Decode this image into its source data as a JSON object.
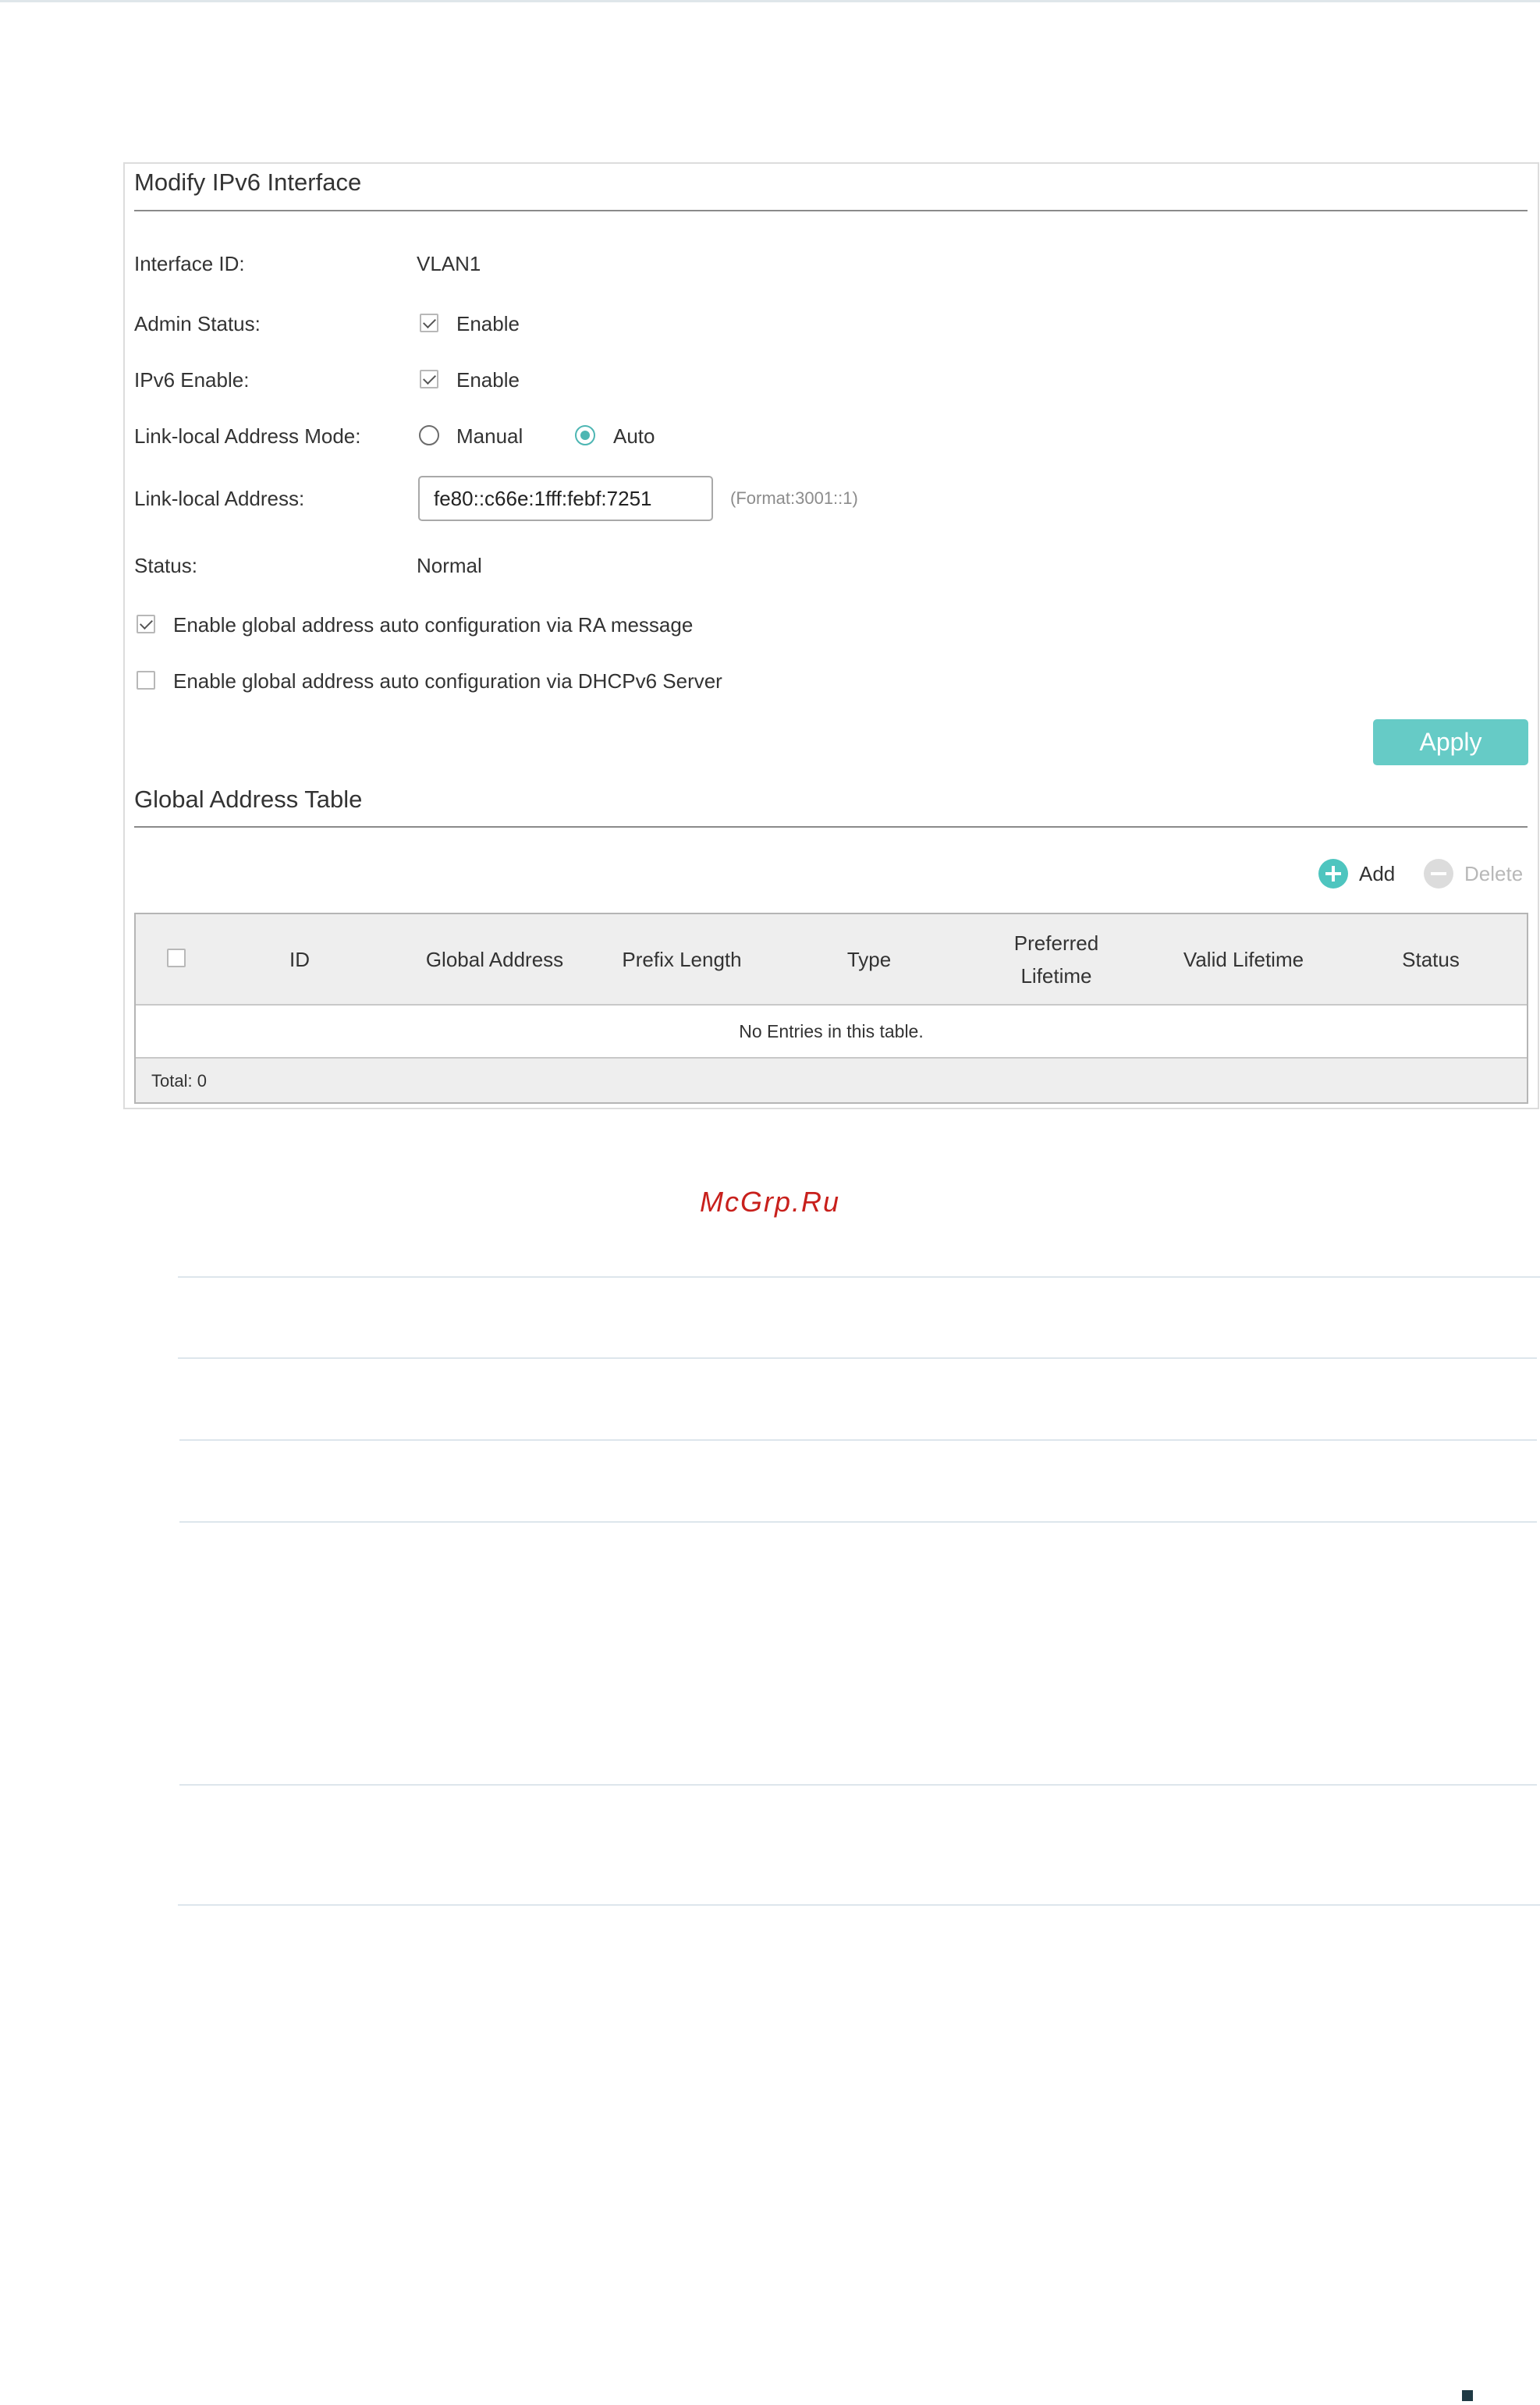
{
  "modify": {
    "title": "Modify IPv6 Interface",
    "interface_id_label": "Interface ID:",
    "interface_id_value": "VLAN1",
    "admin_status_label": "Admin Status:",
    "admin_status_option": "Enable",
    "ipv6_enable_label": "IPv6 Enable:",
    "ipv6_enable_option": "Enable",
    "link_local_mode_label": "Link-local Address Mode:",
    "mode_manual": "Manual",
    "mode_auto": "Auto",
    "link_local_address_label": "Link-local Address:",
    "link_local_address_value": "fe80::c66e:1fff:febf:7251",
    "format_hint": "(Format:3001::1)",
    "status_label": "Status:",
    "status_value": "Normal",
    "ra_label": "Enable global address auto configuration via RA message",
    "dhcp_label": "Enable global address auto configuration via DHCPv6 Server",
    "apply_label": "Apply"
  },
  "global_table": {
    "title": "Global Address Table",
    "add_label": "Add",
    "delete_label": "Delete",
    "columns": {
      "id": "ID",
      "global_address": "Global Address",
      "prefix_length": "Prefix Length",
      "type": "Type",
      "preferred_lifetime_1": "Preferred",
      "preferred_lifetime_2": "Lifetime",
      "valid_lifetime": "Valid Lifetime",
      "status": "Status"
    },
    "empty_text": "No Entries in this table.",
    "total_text": "Total: 0"
  },
  "watermark": "McGrp.Ru",
  "colors": {
    "accent": "#4ec5bf",
    "apply_button": "#66cbc6",
    "watermark": "#c8201c"
  }
}
